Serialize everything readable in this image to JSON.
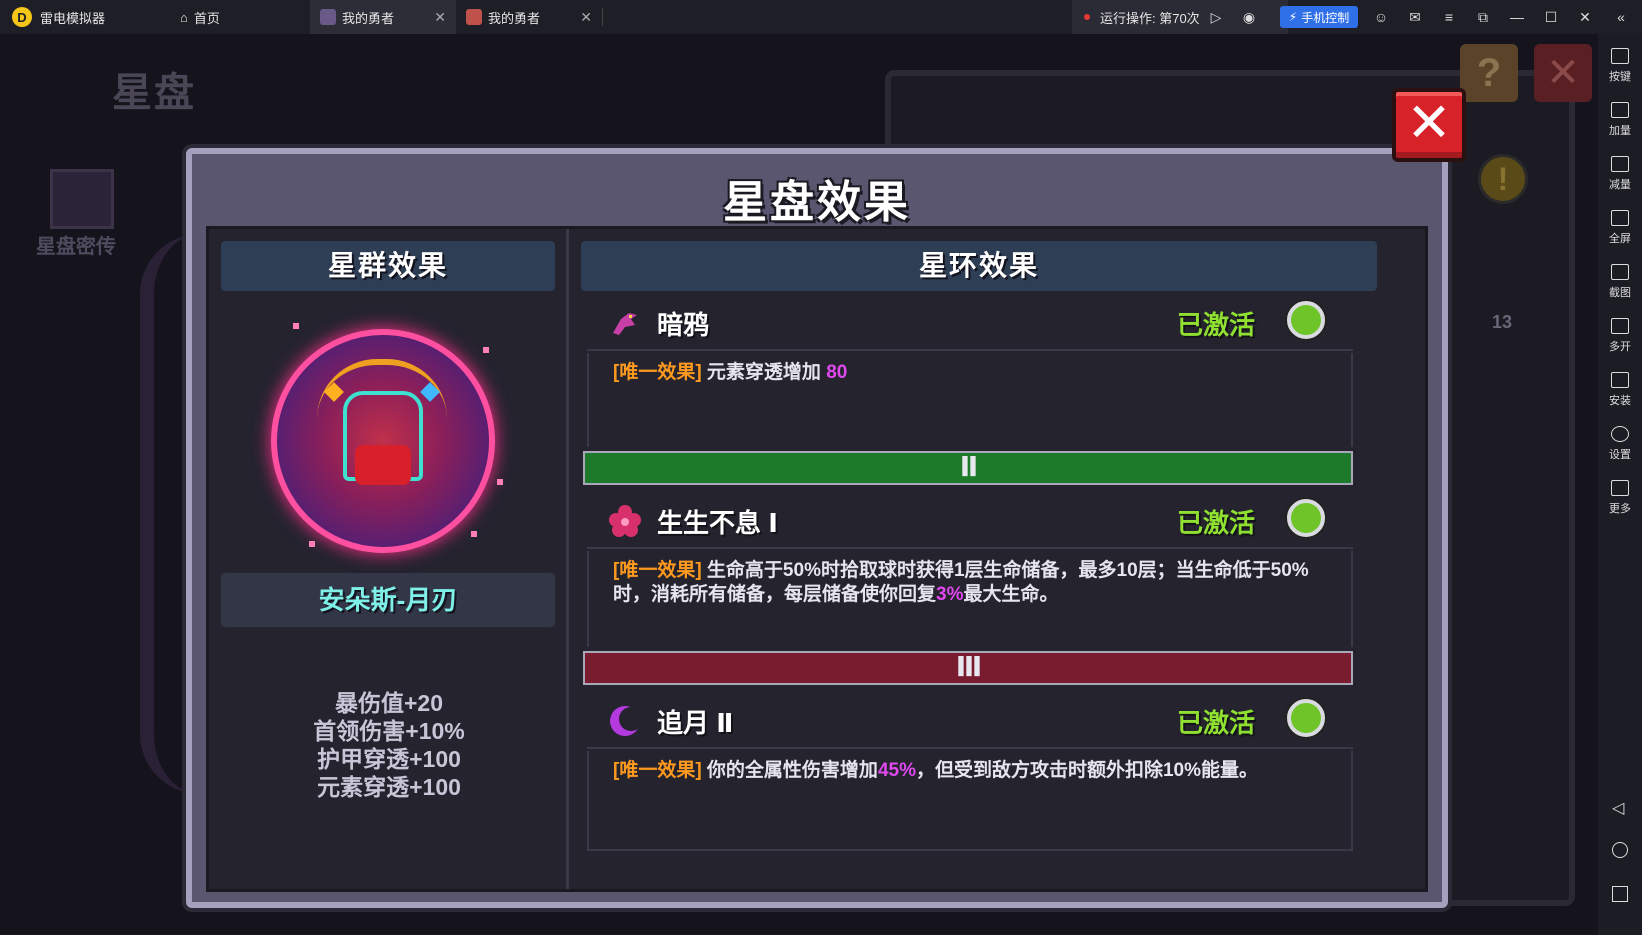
{
  "titlebar": {
    "app_name": "雷电模拟器",
    "tabs": [
      {
        "label": "首页"
      },
      {
        "label": "我的勇者"
      },
      {
        "label": "我的勇者"
      }
    ],
    "run_status": "运行操作: 第70次",
    "phone_control": "手机控制"
  },
  "sidebar": {
    "items": [
      {
        "label": "按键"
      },
      {
        "label": "加量"
      },
      {
        "label": "减量"
      },
      {
        "label": "全屏"
      },
      {
        "label": "截图"
      },
      {
        "label": "多开"
      },
      {
        "label": "安装"
      },
      {
        "label": "设置"
      },
      {
        "label": "更多"
      }
    ]
  },
  "background": {
    "title": "星盘",
    "book_label": "星盘密传",
    "count": "13",
    "help_glyph": "?",
    "warn_glyph": "!"
  },
  "dialog": {
    "title": "星盘效果",
    "close_glyph": "✕",
    "left": {
      "header": "星群效果",
      "hero_name": "安朵斯-月刃",
      "stats": [
        "暴伤值+20",
        "首领伤害+10%",
        "护甲穿透+100",
        "元素穿透+100"
      ]
    },
    "right": {
      "header": "星环效果",
      "effects": [
        {
          "name": "暗鸦",
          "status": "已激活",
          "tag": "[唯一效果]",
          "desc_pre": " 元素穿透增加 ",
          "desc_hl": "80",
          "desc_post": ""
        },
        {
          "name": "生生不息 Ⅰ",
          "status": "已激活",
          "tag": "[唯一效果]",
          "desc_pre": " 生命高于50%时拾取球时获得1层生命储备，最多10层；当生命低于50%时，消耗所有储备，每层储备使你回复",
          "desc_hl": "3%",
          "desc_post": "最大生命。"
        },
        {
          "name": "追月 Ⅱ",
          "status": "已激活",
          "tag": "[唯一效果]",
          "desc_pre": " 你的全属性伤害增加",
          "desc_hl": "45%",
          "desc_post": "，但受到敌方攻击时额外扣除10%能量。"
        }
      ],
      "tiers": [
        "Ⅱ",
        "Ⅲ"
      ]
    }
  },
  "colors": {
    "status_active": "#8fe030",
    "tag": "#ff9a1f",
    "highlight": "#e048f0",
    "hero_name": "#7ff0e8",
    "tier_ii": "#1c7a2a",
    "tier_iii": "#7a1c30",
    "close_red": "#d8222a"
  }
}
